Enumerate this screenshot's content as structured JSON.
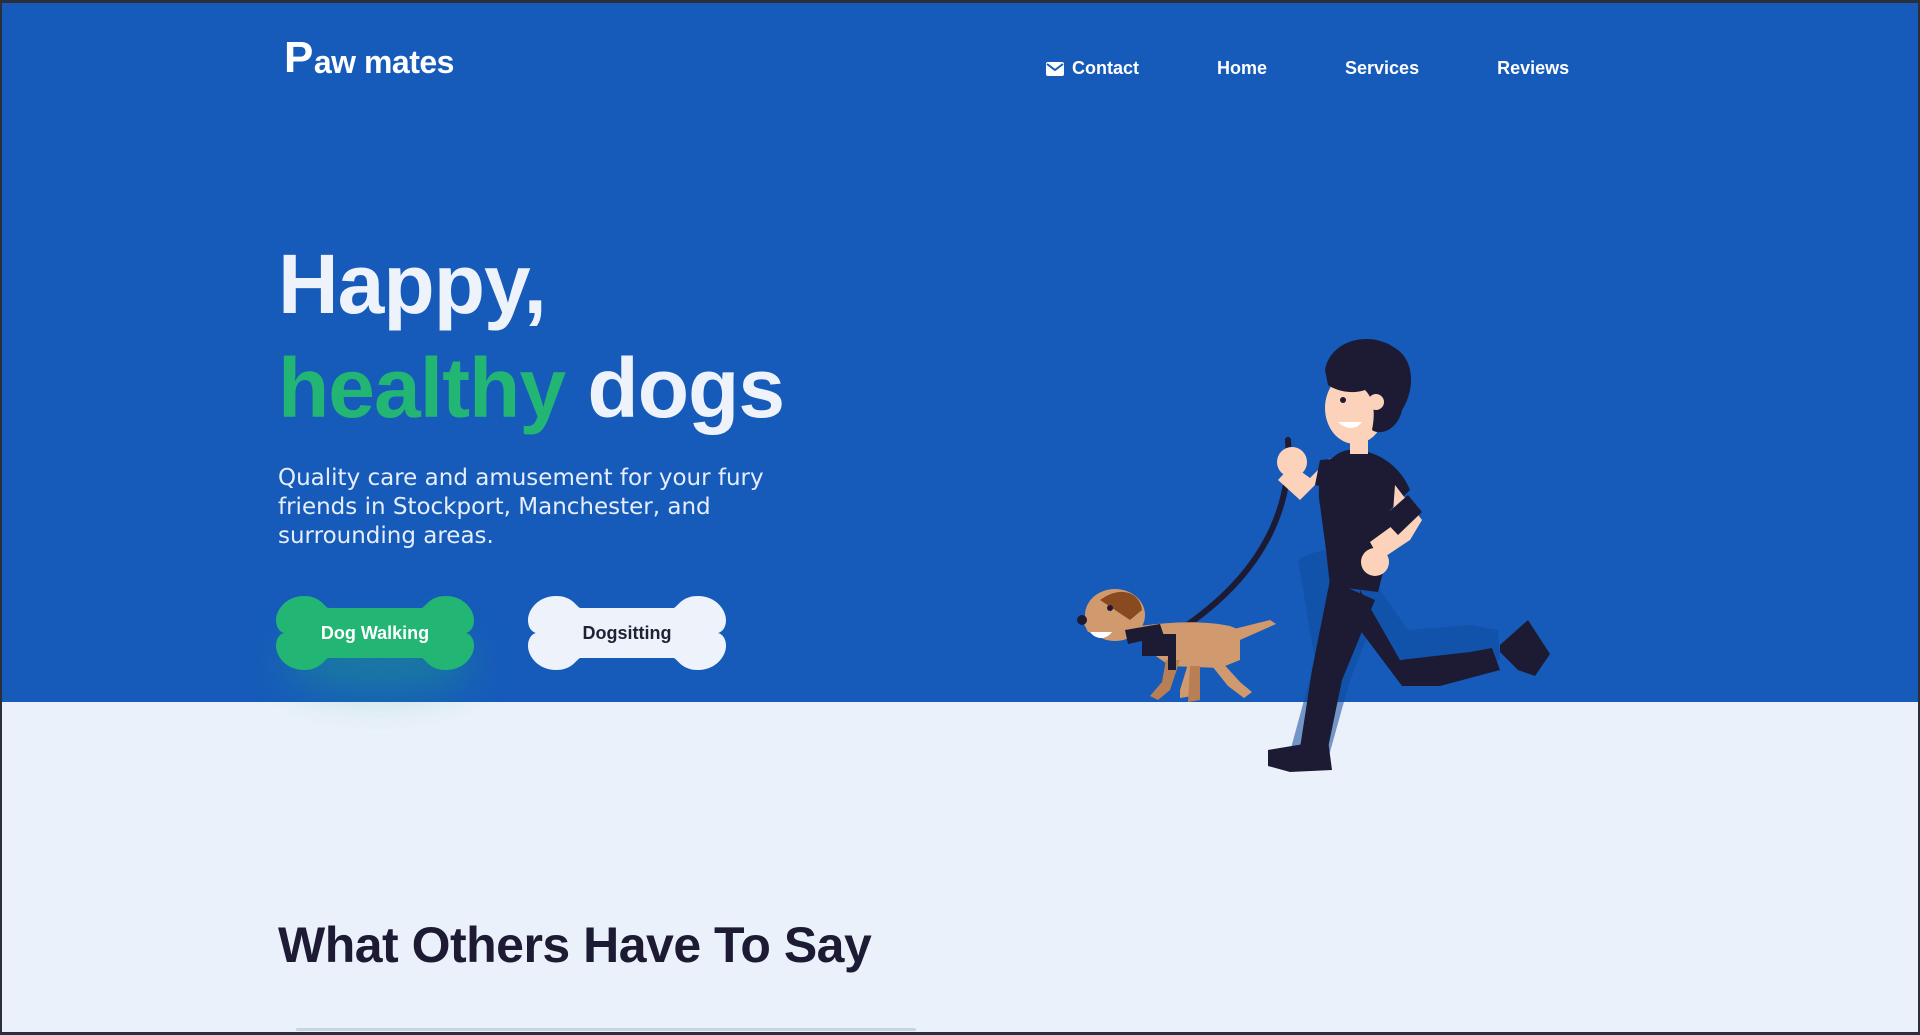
{
  "header": {
    "logo_p": "P",
    "logo_rest": "aw mates",
    "nav": [
      {
        "label": "Contact",
        "icon": "mail-icon"
      },
      {
        "label": "Home"
      },
      {
        "label": "Services"
      },
      {
        "label": "Reviews"
      }
    ]
  },
  "hero": {
    "headline_line1": "Happy,",
    "headline_accent": "healthy",
    "headline_rest": " dogs",
    "subtext": "Quality care and amusement for your fury friends in Stockport, Manchester, and surrounding areas.",
    "buttons": [
      {
        "label": "Dog Walking"
      },
      {
        "label": "Dogsitting"
      }
    ],
    "illustration": "man-walking-dog-illustration"
  },
  "reviews": {
    "title": "What Others Have To Say"
  },
  "colors": {
    "hero_bg": "#165bba",
    "page_bg": "#eaf1fb",
    "accent_green": "#22b573",
    "dark_navy": "#1c1b33"
  }
}
